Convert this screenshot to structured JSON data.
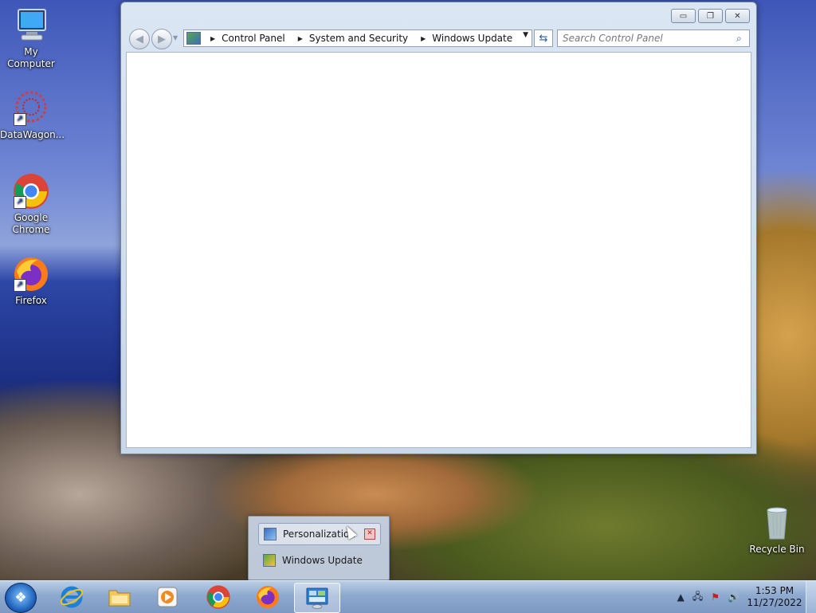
{
  "desktop": {
    "icons": [
      {
        "label": "My Computer",
        "icon": "computer-icon"
      },
      {
        "label": "DataWagon...",
        "icon": "datawagon-icon"
      },
      {
        "label": "Google Chrome",
        "icon": "chrome-icon"
      },
      {
        "label": "Firefox",
        "icon": "firefox-icon"
      },
      {
        "label": "Recycle Bin",
        "icon": "recycle-bin-icon"
      }
    ]
  },
  "window": {
    "breadcrumbs": [
      "Control Panel",
      "System and Security",
      "Windows Update"
    ],
    "search_placeholder": "Search Control Panel",
    "caption": {
      "minimize": "▭",
      "restore": "❐",
      "close": "✕"
    }
  },
  "popup": {
    "items": [
      {
        "label": "Personalization",
        "active": true
      },
      {
        "label": "Windows Update",
        "active": false
      }
    ]
  },
  "taskbar": {
    "apps": [
      "Internet Explorer",
      "Windows Explorer",
      "Media Player",
      "Google Chrome",
      "Firefox",
      "Control Panel"
    ],
    "clock": {
      "time": "1:53 PM",
      "date": "11/27/2022"
    }
  },
  "colors": {
    "taskbar": "#8ea9cf",
    "window_frame": "#c9d7ea",
    "accent": "#2c5aa0"
  }
}
